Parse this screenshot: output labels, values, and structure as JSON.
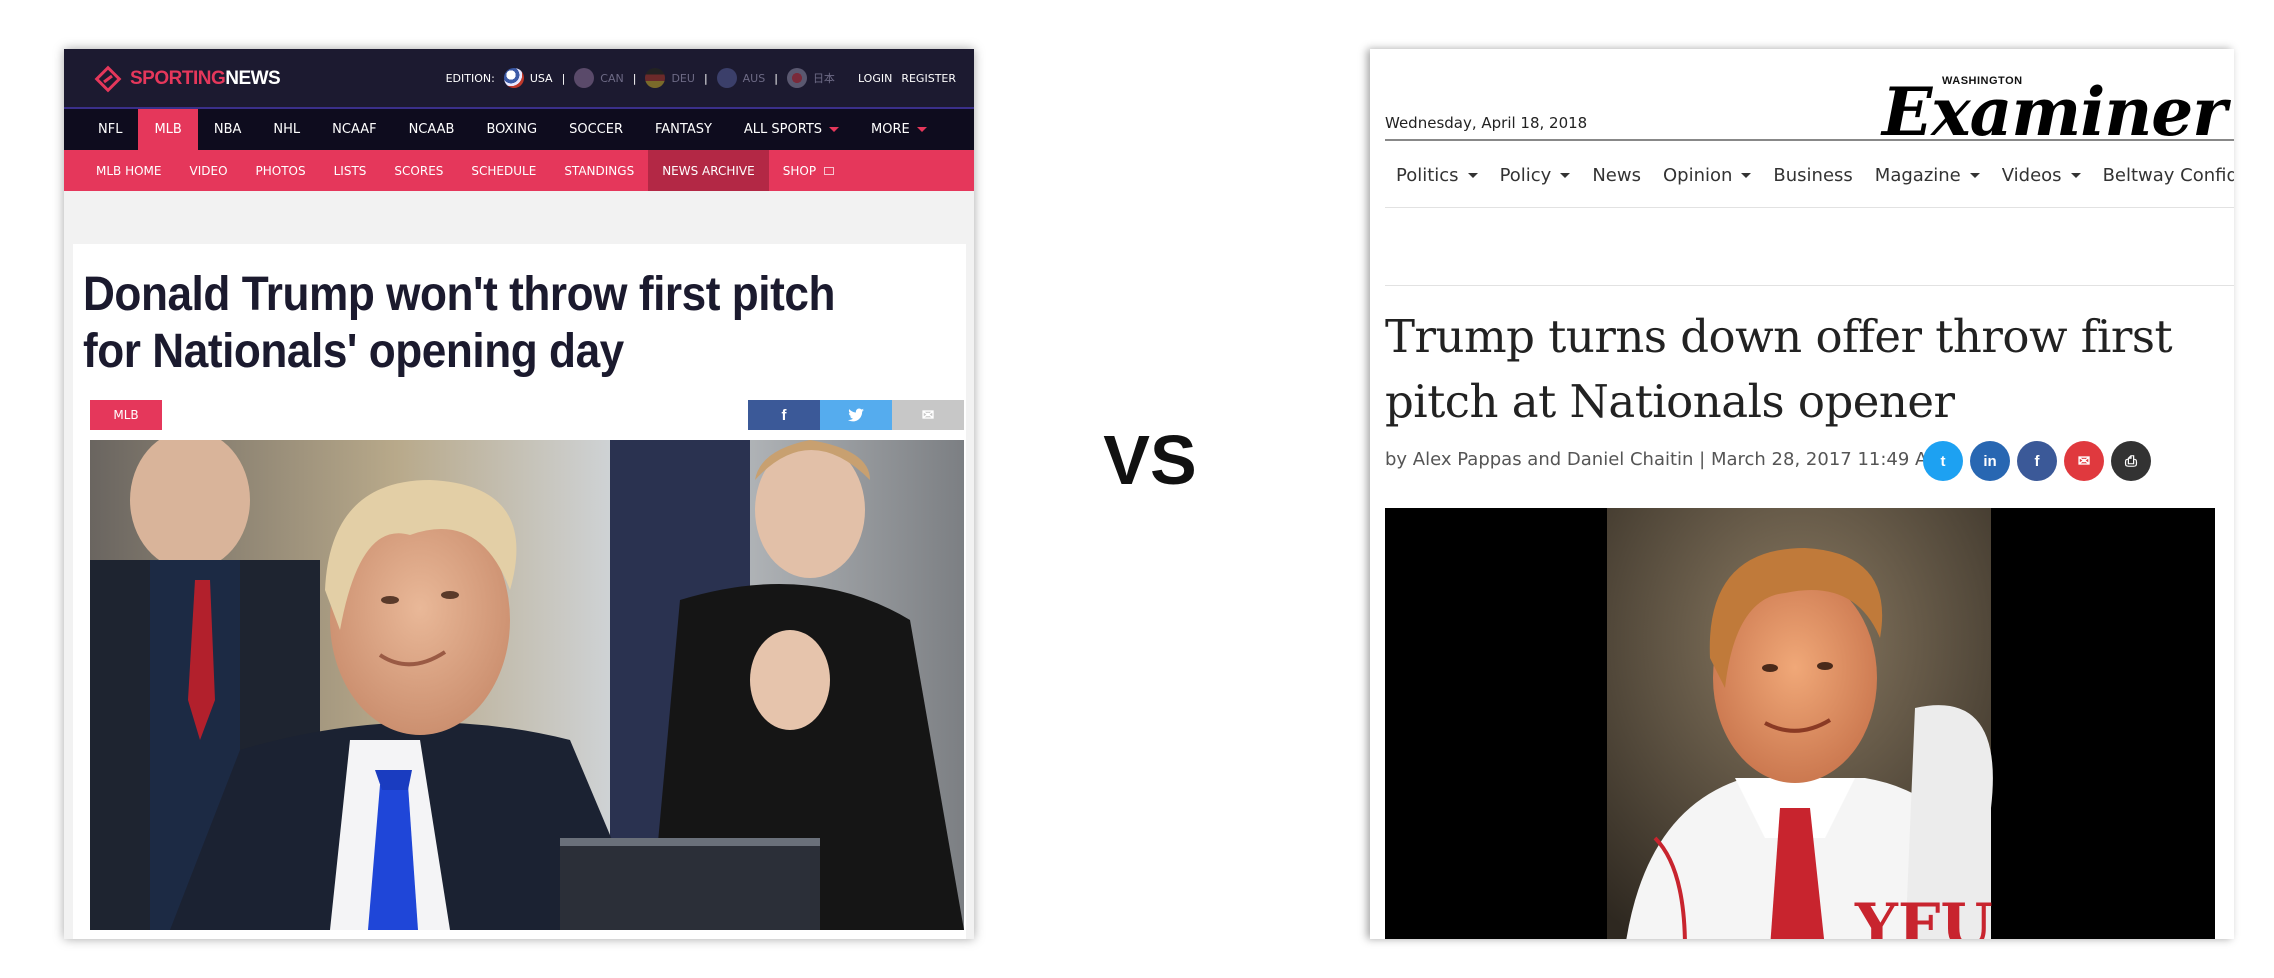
{
  "left": {
    "brand": {
      "part1": "SPORTING",
      "part2": "NEWS"
    },
    "edition": {
      "label": "EDITION:",
      "items": [
        "USA",
        "CAN",
        "DEU",
        "AUS",
        "日本"
      ],
      "login": "LOGIN",
      "register": "REGISTER"
    },
    "nav": [
      "NFL",
      "MLB",
      "NBA",
      "NHL",
      "NCAAF",
      "NCAAB",
      "BOXING",
      "SOCCER",
      "FANTASY",
      "ALL SPORTS",
      "MORE"
    ],
    "subnav": [
      "MLB HOME",
      "VIDEO",
      "PHOTOS",
      "LISTS",
      "SCORES",
      "SCHEDULE",
      "STANDINGS",
      "NEWS ARCHIVE",
      "SHOP"
    ],
    "headline": "Donald Trump won't throw first pitch for Nationals' opening day",
    "tag": "MLB",
    "share": {
      "facebook": "f",
      "twitter": "t",
      "email": "✉"
    },
    "colors": {
      "accent": "#e5375b",
      "dark": "#1c1a30",
      "facebook": "#3b5998",
      "twitter": "#55acee",
      "email": "#bbbbbb"
    }
  },
  "vs": "VS",
  "right": {
    "date": "Wednesday, April 18, 2018",
    "logo": {
      "small": "WASHINGTON",
      "big": "Examiner"
    },
    "nav": [
      "Politics",
      "Policy",
      "News",
      "Opinion",
      "Business",
      "Magazine",
      "Videos",
      "Beltway Confide"
    ],
    "headline": "Trump turns down offer throw first pitch at Nationals opener",
    "byline": "by Alex Pappas and Daniel Chaitin | March 28, 2017 11:49 AM",
    "share": [
      {
        "icon": "twitter-icon",
        "glyph": "t",
        "color": "#1da1f2"
      },
      {
        "icon": "linkedin-icon",
        "glyph": "in",
        "color": "#2867b2"
      },
      {
        "icon": "facebook-icon",
        "glyph": "f",
        "color": "#3b5998"
      },
      {
        "icon": "email-icon",
        "glyph": "✉",
        "color": "#e0393e"
      },
      {
        "icon": "print-icon",
        "glyph": "⎙",
        "color": "#333333"
      }
    ]
  }
}
